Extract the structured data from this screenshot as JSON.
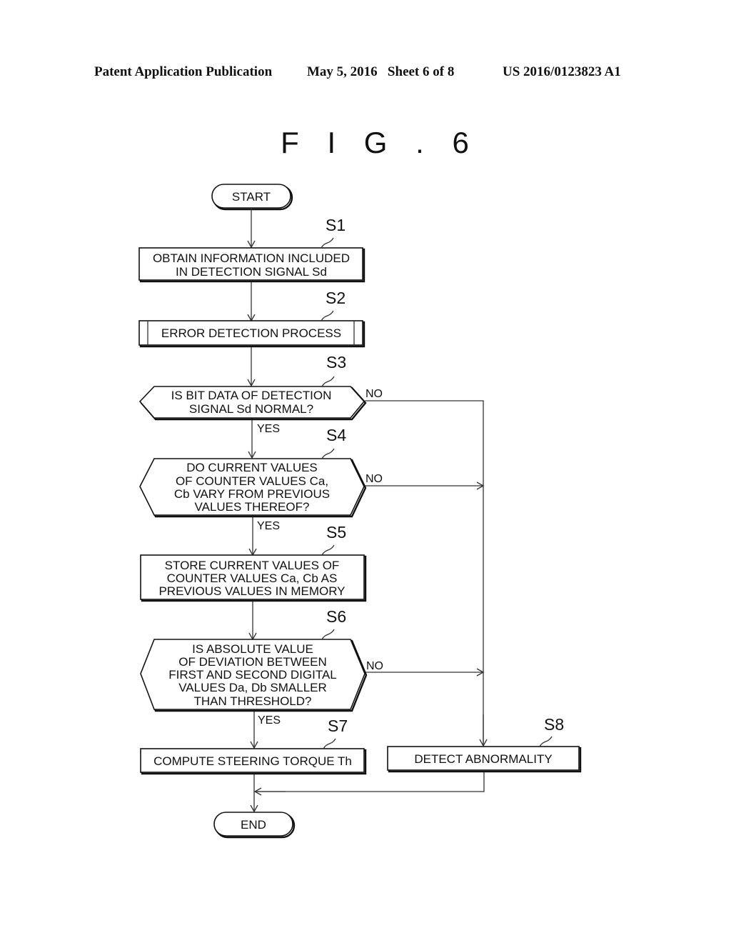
{
  "header": {
    "publication": "Patent Application Publication",
    "date_sheet": "May 5, 2016   Sheet 6 of 8",
    "number": "US 2016/0123823 A1"
  },
  "figure_title": "F I G . 6",
  "flowchart": {
    "start": "START",
    "end": "END",
    "steps": [
      {
        "id": "S1",
        "type": "process",
        "lines": [
          "OBTAIN INFORMATION INCLUDED",
          "IN DETECTION SIGNAL Sd"
        ]
      },
      {
        "id": "S2",
        "type": "subroutine",
        "lines": [
          "ERROR DETECTION PROCESS"
        ]
      },
      {
        "id": "S3",
        "type": "decision",
        "lines": [
          "IS BIT DATA OF DETECTION",
          "SIGNAL Sd NORMAL?"
        ],
        "yes": "YES",
        "no": "NO"
      },
      {
        "id": "S4",
        "type": "decision",
        "lines": [
          "DO CURRENT VALUES",
          "OF COUNTER VALUES Ca,",
          "Cb VARY FROM PREVIOUS",
          "VALUES THEREOF?"
        ],
        "yes": "YES",
        "no": "NO"
      },
      {
        "id": "S5",
        "type": "process",
        "lines": [
          "STORE CURRENT VALUES OF",
          "COUNTER VALUES Ca, Cb AS",
          "PREVIOUS VALUES IN MEMORY"
        ]
      },
      {
        "id": "S6",
        "type": "decision",
        "lines": [
          "IS ABSOLUTE VALUE",
          "OF DEVIATION BETWEEN",
          "FIRST AND SECOND DIGITAL",
          "VALUES Da, Db SMALLER",
          "THAN THRESHOLD?"
        ],
        "yes": "YES",
        "no": "NO"
      },
      {
        "id": "S7",
        "type": "process",
        "lines": [
          "COMPUTE STEERING TORQUE Th"
        ]
      },
      {
        "id": "S8",
        "type": "process",
        "lines": [
          "DETECT ABNORMALITY"
        ]
      }
    ]
  }
}
